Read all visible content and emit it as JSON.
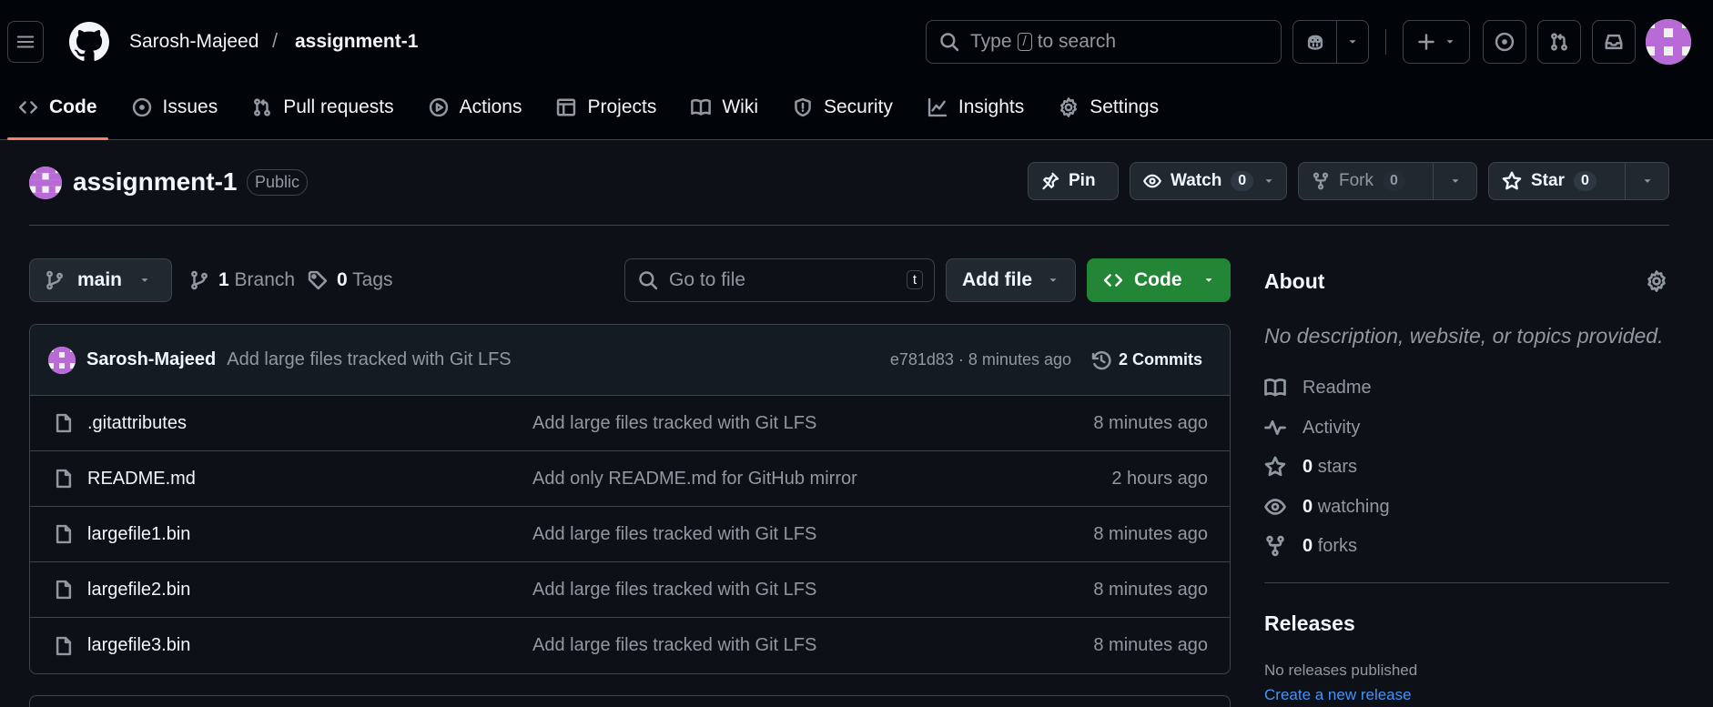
{
  "header": {
    "owner": "Sarosh-Majeed",
    "separator": "/",
    "repo": "assignment-1",
    "search": {
      "prefix": "Type",
      "key": "/",
      "suffix": "to search"
    }
  },
  "repo_nav": {
    "tabs": [
      {
        "label": "Code",
        "icon": "code-icon",
        "active": true
      },
      {
        "label": "Issues",
        "icon": "issue-opened-icon"
      },
      {
        "label": "Pull requests",
        "icon": "git-pull-request-icon"
      },
      {
        "label": "Actions",
        "icon": "play-icon"
      },
      {
        "label": "Projects",
        "icon": "table-icon"
      },
      {
        "label": "Wiki",
        "icon": "book-icon"
      },
      {
        "label": "Security",
        "icon": "shield-icon"
      },
      {
        "label": "Insights",
        "icon": "graph-icon"
      },
      {
        "label": "Settings",
        "icon": "gear-icon"
      }
    ]
  },
  "repo_header": {
    "title": "assignment-1",
    "visibility": "Public",
    "pin_label": "Pin",
    "watch_label": "Watch",
    "watch_count": "0",
    "fork_label": "Fork",
    "fork_count": "0",
    "star_label": "Star",
    "star_count": "0"
  },
  "toolbar": {
    "branch": "main",
    "branch_count": "1",
    "branch_word": "Branch",
    "tag_count": "0",
    "tag_word": "Tags",
    "goto_placeholder": "Go to file",
    "goto_key": "t",
    "add_file_label": "Add file",
    "code_label": "Code"
  },
  "latest_commit": {
    "author": "Sarosh-Majeed",
    "message": "Add large files tracked with Git LFS",
    "meta": "e781d83 · 8 minutes ago",
    "commits_label": "2 Commits"
  },
  "files": [
    {
      "name": ".gitattributes",
      "message": "Add large files tracked with Git LFS",
      "age": "8 minutes ago"
    },
    {
      "name": "README.md",
      "message": "Add only README.md for GitHub mirror",
      "age": "2 hours ago"
    },
    {
      "name": "largefile1.bin",
      "message": "Add large files tracked with Git LFS",
      "age": "8 minutes ago"
    },
    {
      "name": "largefile2.bin",
      "message": "Add large files tracked with Git LFS",
      "age": "8 minutes ago"
    },
    {
      "name": "largefile3.bin",
      "message": "Add large files tracked with Git LFS",
      "age": "8 minutes ago"
    }
  ],
  "about": {
    "heading": "About",
    "description": "No description, website, or topics provided.",
    "items": [
      {
        "count": "",
        "label": "Readme",
        "icon": "book-icon"
      },
      {
        "count": "",
        "label": "Activity",
        "icon": "pulse-icon"
      },
      {
        "count": "0",
        "label": "stars",
        "icon": "star-icon"
      },
      {
        "count": "0",
        "label": "watching",
        "icon": "eye-icon"
      },
      {
        "count": "0",
        "label": "forks",
        "icon": "repo-forked-icon"
      }
    ]
  },
  "releases": {
    "heading": "Releases",
    "empty_text": "No releases published",
    "create_link": "Create a new release"
  },
  "colors": {
    "background": "#0d1117",
    "header_bg": "#010409",
    "border": "#3d444d",
    "accent_underline": "#f78166",
    "code_button": "#238636",
    "link": "#4493f8",
    "avatar": "#b86bd7"
  }
}
